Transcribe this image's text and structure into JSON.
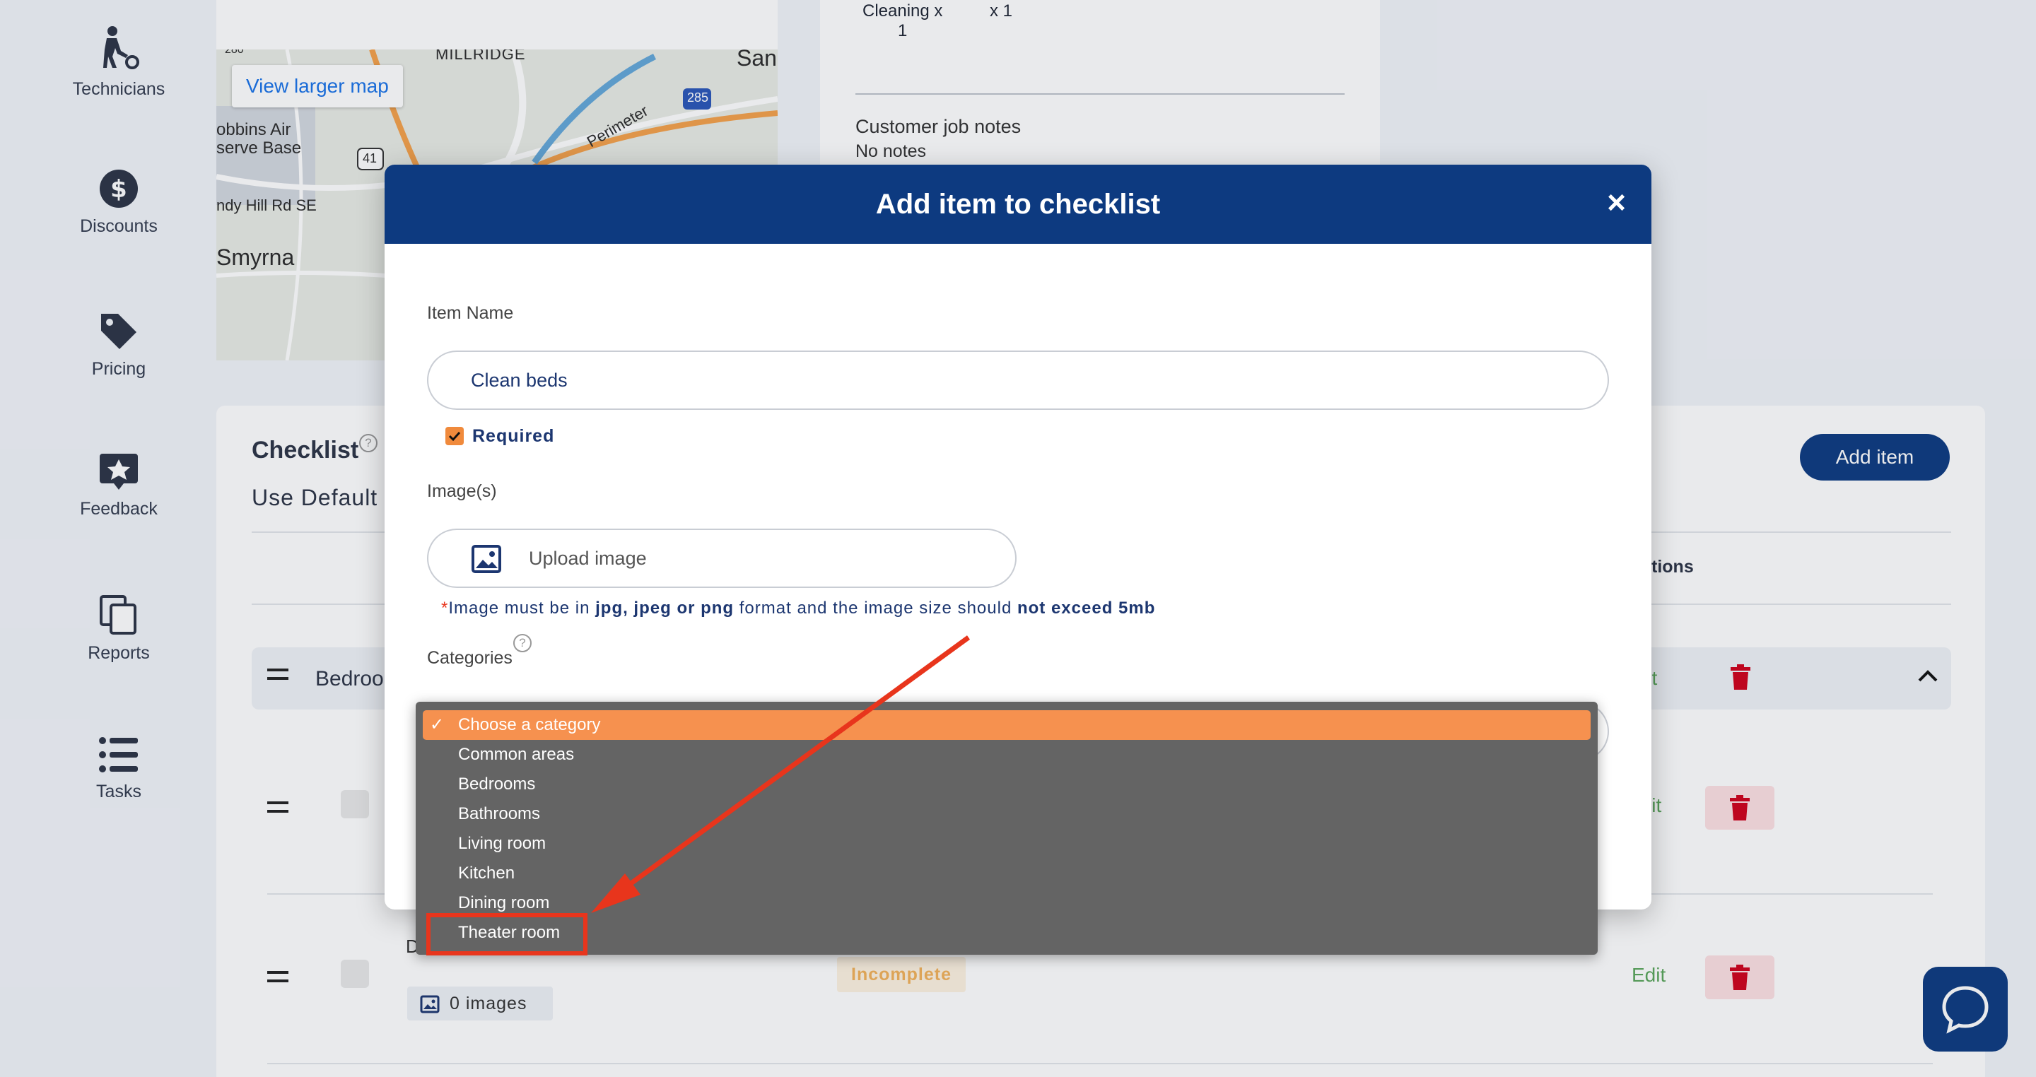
{
  "sidebar": {
    "items": [
      {
        "label": "Technicians",
        "icon": "technician-icon"
      },
      {
        "label": "Discounts",
        "icon": "dollar-icon"
      },
      {
        "label": "Pricing",
        "icon": "tag-icon"
      },
      {
        "label": "Feedback",
        "icon": "feedback-star-icon"
      },
      {
        "label": "Reports",
        "icon": "copy-icon"
      },
      {
        "label": "Tasks",
        "icon": "list-icon"
      }
    ]
  },
  "map": {
    "view_larger": "View larger map",
    "labels": {
      "millridge": "MILLRIDGE",
      "san": "San",
      "dobbins": "obbins Air",
      "reserve": "serve Base",
      "sandy": "ndy Hill Rd SE",
      "smyrna": "Smyrna",
      "perimeter": "Perimeter",
      "i285": "285",
      "us41": "41",
      "r280": "280"
    }
  },
  "job_summary": {
    "cleaning_line1": "Cleaning x",
    "cleaning_line2": "1",
    "cleaning_qty": "x 1",
    "notes_label": "Customer job notes",
    "notes_value": "No notes"
  },
  "checklist": {
    "title": "Checklist",
    "use_default": "Use Default",
    "add_item": "Add item",
    "actions_header": "tions",
    "group_name": "Bedroo",
    "edit_label_partial": "lit",
    "row2": {
      "name": "D",
      "images": "0 images",
      "status": "Incomplete",
      "edit": "Edit"
    }
  },
  "modal": {
    "title": "Add item to checklist",
    "close": "×",
    "item_name_label": "Item Name",
    "item_name_value": "Clean beds",
    "required_label": "Required",
    "images_label": "Image(s)",
    "upload_label": "Upload image",
    "hint_star": "*",
    "hint_1": "Image must be in ",
    "hint_formats": "jpg, jpeg or png",
    "hint_2": " format and the image size should ",
    "hint_limit": "not exceed 5mb",
    "categories_label": "Categories"
  },
  "dropdown": {
    "options": [
      "Choose a category",
      "Common areas",
      "Bedrooms",
      "Bathrooms",
      "Living room",
      "Kitchen",
      "Dining room",
      "Theater room"
    ],
    "selected": "Choose a category",
    "check": "✓"
  },
  "colors": {
    "brand_navy": "#0d3a80",
    "accent_orange": "#f6914f",
    "annotation_red": "#e8351c",
    "delete_red": "#d0021b",
    "edit_green": "#5aa55a"
  }
}
